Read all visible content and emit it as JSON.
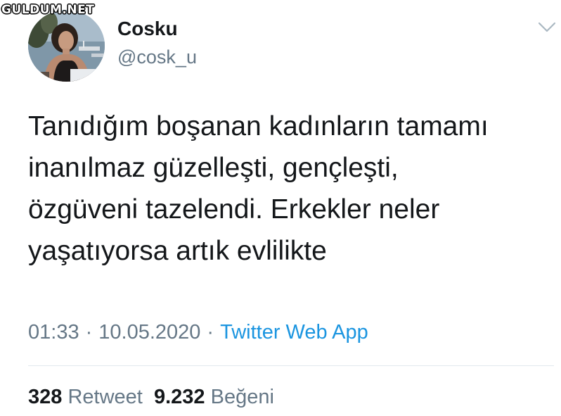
{
  "watermark": "GULDUM.NET",
  "profile": {
    "display_name": "Cosku",
    "handle": "@cosk_u",
    "avatar": "profile-photo"
  },
  "tweet": {
    "text": "Tanıdığım boşanan kadınların tamamı\ninanılmaz güzelleşti, gençleşti,\nözgüveni tazelendi. Erkekler neler\nyaşatıyorsa artık evlilikte",
    "time": "01:33",
    "separator": "·",
    "date": "10.05.2020",
    "source": "Twitter Web App"
  },
  "stats": {
    "retweet_count": "328",
    "retweet_label": "Retweet",
    "like_count": "9.232",
    "like_label": "Beğeni"
  },
  "icons": {
    "menu": "chevron-down-icon"
  },
  "colors": {
    "text_primary": "#14171a",
    "text_secondary": "#657786",
    "link": "#1b95e0",
    "divider": "#e1e8ed"
  }
}
